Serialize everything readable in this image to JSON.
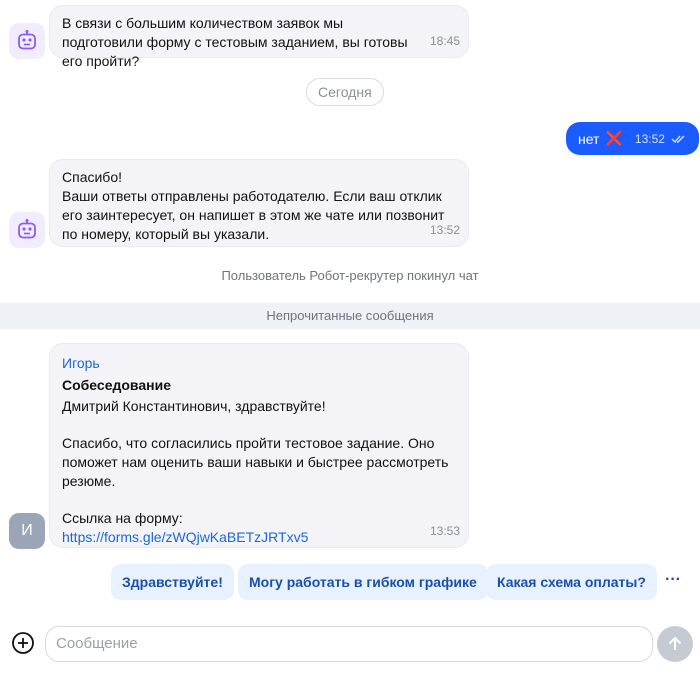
{
  "messages": {
    "bot1": {
      "text": "В связи с большим количеством заявок мы подготовили форму с тестовым заданием, вы готовы его пройти?",
      "time": "18:45"
    },
    "date_divider": "Сегодня",
    "user_reply": {
      "text": "нет",
      "emoji": "❌",
      "time": "13:52"
    },
    "bot2": {
      "line1": "Спасибо!",
      "line2": "Ваши ответы отправлены работодателю. Если ваш отклик его заинтересует, он напишет в этом же чате или позвонит по номеру, который вы указали.",
      "time": "13:52"
    },
    "system_left": "Пользователь Робот-рекрутер покинул чат",
    "unread_divider": "Непрочитанные сообщения",
    "recruiter": {
      "avatar_letter": "И",
      "sender": "Игорь",
      "subject": "Собеседование",
      "greeting": "Дмитрий Константинович, здравствуйте!",
      "body": "Спасибо, что согласились пройти тестовое задание. Оно поможет нам оценить ваши навыки и быстрее рассмотреть резюме.",
      "link_label": "Ссылка на форму:",
      "link": "https://forms.gle/zWQjwKaBETzJRTxv5",
      "time": "13:53"
    }
  },
  "quick_replies": [
    "Здравствуйте!",
    "Могу работать в гибком графике",
    "Какая схема оплаты?"
  ],
  "more_label": "···",
  "composer": {
    "placeholder": "Сообщение"
  },
  "colors": {
    "accent": "#1a5cff",
    "link": "#1a68d8",
    "bot_avatar_bg": "#f1ecff",
    "bot_icon": "#8b5cf6"
  },
  "icons": {
    "bot_avatar": "robot-icon",
    "attach": "plus-circle-icon",
    "send": "arrow-up-icon",
    "read_status": "double-check-icon"
  }
}
